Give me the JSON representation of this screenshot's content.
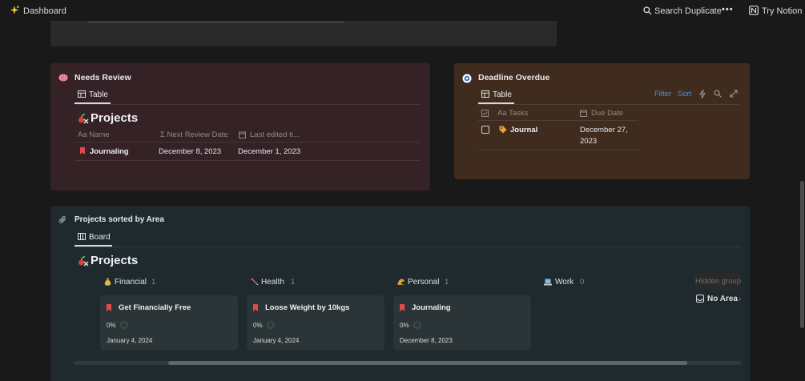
{
  "topbar": {
    "page_title": "Dashboard",
    "search_label": "Search",
    "duplicate_label": "Duplicate",
    "more_label": "•••",
    "try_notion_label": "Try Notion"
  },
  "needs_review": {
    "title": "Needs Review",
    "tab_label": "Table",
    "db_title": "Projects",
    "columns": [
      "Name",
      "Next Review Date",
      "Last edited ti..."
    ],
    "column_prefixes": [
      "Aa",
      "Σ",
      ""
    ],
    "rows": [
      {
        "name": "Journaling",
        "next_review": "December 8, 2023",
        "last_edited": "December 1, 2023"
      }
    ]
  },
  "deadline_overdue": {
    "title": "Deadline Overdue",
    "tab_label": "Table",
    "filter_label": "Filter",
    "sort_label": "Sort",
    "columns": [
      "Tasks",
      "Due Date"
    ],
    "column_prefix": "Aa",
    "rows": [
      {
        "task": "Journal",
        "due_line1": "December 27,",
        "due_line2": "2023"
      }
    ]
  },
  "projects_by_area": {
    "title": "Projects sorted by Area",
    "tab_label": "Board",
    "db_title": "Projects",
    "groups": [
      {
        "label": "Financial",
        "count": "1"
      },
      {
        "label": "Health",
        "count": "1"
      },
      {
        "label": "Personal",
        "count": "1"
      },
      {
        "label": "Work",
        "count": "0"
      }
    ],
    "cards": [
      {
        "title": "Get Financially Free",
        "progress": "0%",
        "date": "January 4, 2024"
      },
      {
        "title": "Loose Weight by 10kgs",
        "progress": "0%",
        "date": "January 4, 2024"
      },
      {
        "title": "Journaling",
        "progress": "0%",
        "date": "December 8, 2023"
      }
    ],
    "hidden_groups_label": "Hidden groups",
    "no_area_label": "No Area"
  },
  "colors": {
    "background": "#191919",
    "needs_review_bg": "#352226",
    "deadline_bg": "#3f2c1f",
    "board_bg": "#1e2a2d",
    "link_blue": "#4a8fe0",
    "bookmark_red": "#e24a4a"
  },
  "icons": [
    "sparkle-icon",
    "search-icon",
    "notion-logo-icon",
    "brain-icon",
    "record-icon",
    "table-icon",
    "paperclip-icon",
    "board-icon",
    "bookmark-icon",
    "tag-icon",
    "money-bag-icon",
    "syringe-icon",
    "wave-icon",
    "laptop-icon",
    "inbox-icon",
    "lightning-icon",
    "expand-icon",
    "checkbox-icon",
    "calendar-icon"
  ]
}
